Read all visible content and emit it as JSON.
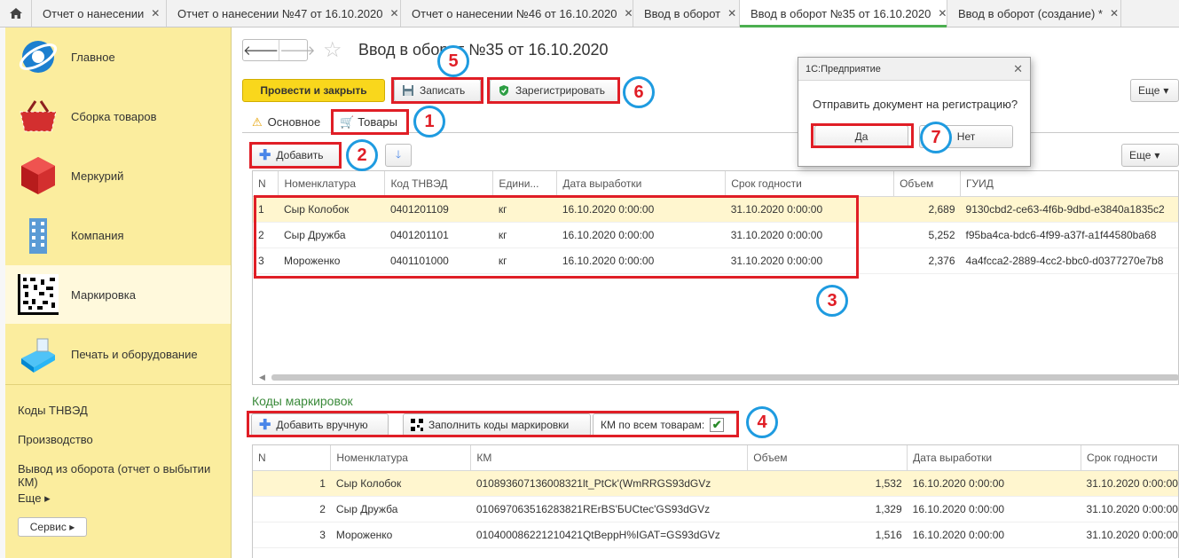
{
  "window_tabs": [
    {
      "label": "Отчет о нанесении"
    },
    {
      "label": "Отчет о нанесении №47 от 16.10.2020"
    },
    {
      "label": "Отчет о нанесении №46 от 16.10.2020"
    },
    {
      "label": "Ввод в оборот"
    },
    {
      "label": "Ввод в оборот №35 от 16.10.2020"
    },
    {
      "label": "Ввод в оборот (создание) *"
    }
  ],
  "sidebar": {
    "items": [
      {
        "label": "Главное"
      },
      {
        "label": "Сборка товаров"
      },
      {
        "label": "Меркурий"
      },
      {
        "label": "Компания"
      },
      {
        "label": "Маркировка"
      },
      {
        "label": "Печать и оборудование"
      }
    ],
    "links": [
      "Коды ТНВЭД",
      "Производство",
      "Вывод из оборота (отчет о выбытии КМ)",
      "Еще ▸"
    ],
    "service_label": "Сервис ▸"
  },
  "document": {
    "title": "Ввод в оборот №35 от 16.10.2020",
    "post_close_label": "Провести и закрыть",
    "save_label": "Записать",
    "register_label": "Зарегистрировать",
    "more_label": "Еще",
    "tabs": [
      "Основное",
      "Товары"
    ]
  },
  "goods": {
    "add_label": "Добавить",
    "more_label": "Еще",
    "columns": [
      "N",
      "Номенклатура",
      "Код ТНВЭД",
      "Едини...",
      "Дата выработки",
      "Срок годности",
      "Объем",
      "ГУИД"
    ],
    "rows": [
      {
        "n": "1",
        "name": "Сыр Колобок",
        "code": "0401201109",
        "unit": "кг",
        "prod_date": "16.10.2020 0:00:00",
        "exp_date": "31.10.2020 0:00:00",
        "volume": "2,689",
        "guid": "9130cbd2-ce63-4f6b-9dbd-e3840a1835c2"
      },
      {
        "n": "2",
        "name": "Сыр Дружба",
        "code": "0401201101",
        "unit": "кг",
        "prod_date": "16.10.2020 0:00:00",
        "exp_date": "31.10.2020 0:00:00",
        "volume": "5,252",
        "guid": "f95ba4ca-bdc6-4f99-a37f-a1f44580ba68"
      },
      {
        "n": "3",
        "name": "Мороженко",
        "code": "0401101000",
        "unit": "кг",
        "prod_date": "16.10.2020 0:00:00",
        "exp_date": "31.10.2020 0:00:00",
        "volume": "2,376",
        "guid": "4a4fcca2-2889-4cc2-bbc0-d0377270e7b8"
      }
    ]
  },
  "codes": {
    "section_title": "Коды маркировок",
    "add_manual_label": "Добавить вручную",
    "fill_codes_label": "Заполнить коды маркировки",
    "km_all_label": "КМ по всем товарам:",
    "km_all_checked": true,
    "columns": [
      "N",
      "Номенклатура",
      "КМ",
      "Объем",
      "Дата выработки",
      "Срок годности"
    ],
    "rows": [
      {
        "n": "1",
        "name": "Сыр Колобок",
        "km": "010893607136008321lt_PtCk'(WmRRGS93dGVz",
        "volume": "1,532",
        "prod_date": "16.10.2020 0:00:00",
        "exp_date": "31.10.2020 0:00:00"
      },
      {
        "n": "2",
        "name": "Сыр Дружба",
        "km": "010697063516283821RErBS'БUCtec'GS93dGVz",
        "volume": "1,329",
        "prod_date": "16.10.2020 0:00:00",
        "exp_date": "31.10.2020 0:00:00"
      },
      {
        "n": "3",
        "name": "Мороженко",
        "km": "010400086221210421QtBeppH%IGAT=GS93dGVz",
        "volume": "1,516",
        "prod_date": "16.10.2020 0:00:00",
        "exp_date": "31.10.2020 0:00:00"
      }
    ]
  },
  "dialog": {
    "title": "1С:Предприятие",
    "message": "Отправить документ на регистрацию?",
    "yes_label": "Да",
    "no_label": "Нет"
  },
  "annotations": [
    "1",
    "2",
    "3",
    "4",
    "5",
    "6",
    "7"
  ],
  "colors": {
    "accent_yellow": "#f9d71c",
    "sidebar_bg": "#fbed9e",
    "annotation_red": "#e01e26",
    "annotation_blue": "#1e9be0",
    "section_green": "#3a8a3a"
  }
}
